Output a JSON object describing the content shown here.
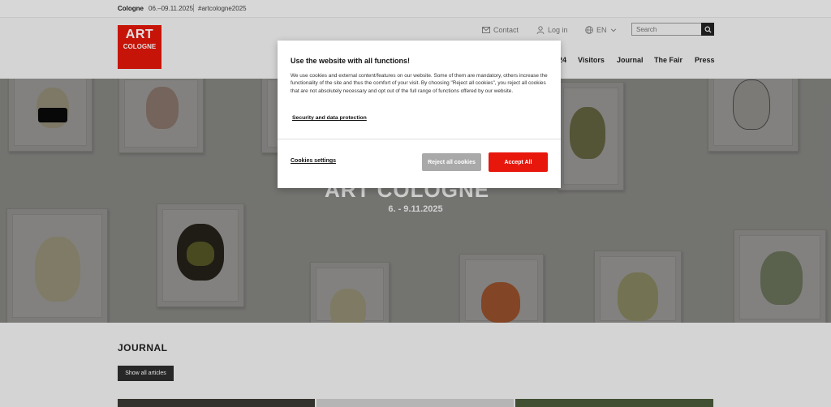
{
  "topbar": {
    "city": "Cologne",
    "dates": "06.–09.11.2025",
    "hashtag": "#artcologne2025"
  },
  "logo": {
    "line1": "ART",
    "line2": "COLOGNE"
  },
  "utility": {
    "contact": "Contact",
    "login": "Log in",
    "language": "EN",
    "search_placeholder": "Search"
  },
  "nav": {
    "partial_item": "24",
    "items": [
      "Visitors",
      "Journal",
      "The Fair",
      "Press"
    ]
  },
  "hero": {
    "title": "ART COLOGNE",
    "date": "6. - 9.11.2025"
  },
  "journal": {
    "title": "JOURNAL",
    "button": "Show all articles"
  },
  "modal": {
    "title": "Use the website with all functions!",
    "body": "We use cookies and external content/features on our website. Some of them are mandatory, others increase the functionality of the site and thus the comfort of your visit. By choosing \"Reject all cookies\", you reject all cookies that are not absolutely necessary and opt out of the full range of functions offered by our website.",
    "privacy_link": "Security and data protection",
    "settings_link": "Cookies settings",
    "reject_button": "Reject all cookies",
    "accept_button": "Accept All"
  },
  "colors": {
    "brand_red": "#e3170a",
    "accept_red": "#e8170c",
    "reject_gray": "#a9a9a9",
    "dark": "#2d2d2d"
  }
}
